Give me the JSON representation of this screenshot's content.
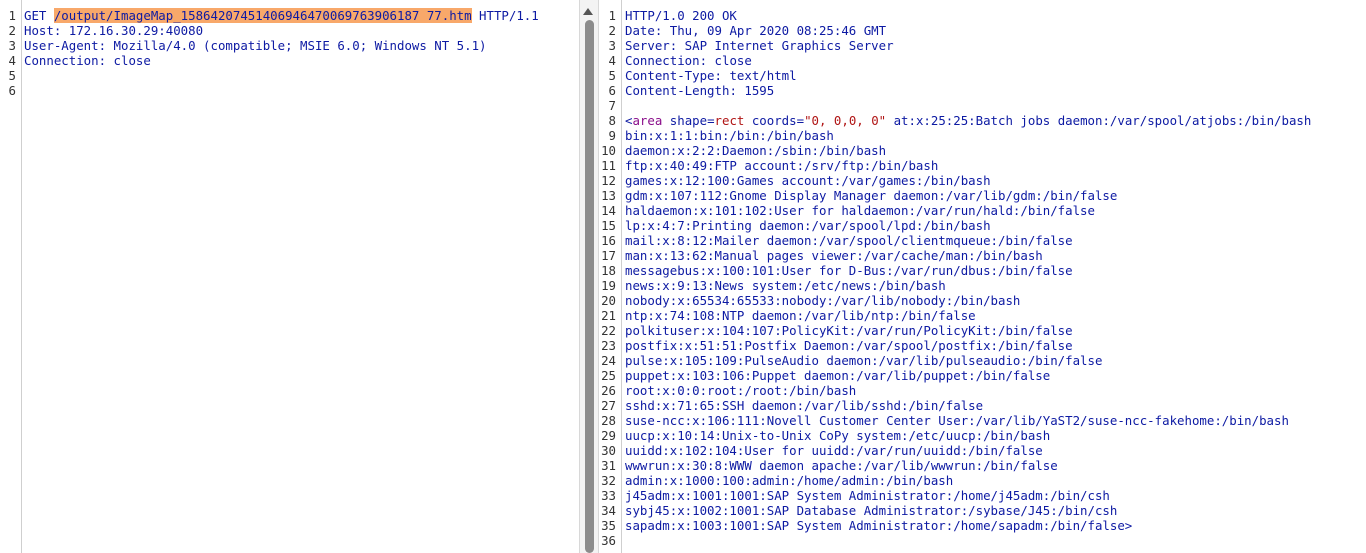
{
  "request": {
    "lines": [
      {
        "n": "1",
        "parts": [
          [
            "t",
            "GET "
          ],
          [
            "hl",
            "/output/ImageMap_15864207451406946470069763906187 77.htm"
          ],
          [
            "t",
            " HTTP/1.1"
          ]
        ]
      },
      {
        "n": "2",
        "parts": [
          [
            "k",
            "Host"
          ],
          [
            "t",
            ": 172.16.30.29:40080"
          ]
        ]
      },
      {
        "n": "3",
        "parts": [
          [
            "k",
            "User-Agent"
          ],
          [
            "t",
            ": Mozilla/4.0 (compatible; MSIE 6.0; Windows NT 5.1)"
          ]
        ]
      },
      {
        "n": "4",
        "parts": [
          [
            "k",
            "Connection"
          ],
          [
            "t",
            ": close"
          ]
        ]
      },
      {
        "n": "5",
        "parts": []
      },
      {
        "n": "6",
        "parts": []
      }
    ]
  },
  "response": {
    "lines": [
      {
        "n": "1",
        "parts": [
          [
            "t",
            "HTTP/1.0 200 OK"
          ]
        ]
      },
      {
        "n": "2",
        "parts": [
          [
            "k",
            "Date"
          ],
          [
            "t",
            ": Thu, 09 Apr 2020 08:25:46 GMT"
          ]
        ]
      },
      {
        "n": "3",
        "parts": [
          [
            "k",
            "Server"
          ],
          [
            "t",
            ": SAP Internet Graphics Server"
          ]
        ]
      },
      {
        "n": "4",
        "parts": [
          [
            "k",
            "Connection"
          ],
          [
            "t",
            ": close"
          ]
        ]
      },
      {
        "n": "5",
        "parts": [
          [
            "k",
            "Content-Type"
          ],
          [
            "t",
            ": text/html"
          ]
        ]
      },
      {
        "n": "6",
        "parts": [
          [
            "k",
            "Content-Length"
          ],
          [
            "t",
            ": 1595"
          ]
        ]
      },
      {
        "n": "7",
        "parts": []
      },
      {
        "n": "8",
        "parts": [
          [
            "tag",
            "<"
          ],
          [
            "attr",
            "area"
          ],
          [
            "tag",
            " shape="
          ],
          [
            "val",
            "rect"
          ],
          [
            "tag",
            " coords="
          ],
          [
            "val",
            "\"0, 0,0, 0\""
          ],
          [
            "tag",
            " at:x:25:25:Batch jobs daemon:/var/spool/atjobs:/bin/bash"
          ]
        ]
      },
      {
        "n": "9",
        "parts": [
          [
            "tag",
            "bin:x:1:1:bin:/bin:/bin/bash"
          ]
        ]
      },
      {
        "n": "10",
        "parts": [
          [
            "tag",
            "daemon:x:2:2:Daemon:/sbin:/bin/bash"
          ]
        ]
      },
      {
        "n": "11",
        "parts": [
          [
            "tag",
            "ftp:x:40:49:FTP account:/srv/ftp:/bin/bash"
          ]
        ]
      },
      {
        "n": "12",
        "parts": [
          [
            "tag",
            "games:x:12:100:Games account:/var/games:/bin/bash"
          ]
        ]
      },
      {
        "n": "13",
        "parts": [
          [
            "tag",
            "gdm:x:107:112:Gnome Display Manager daemon:/var/lib/gdm:/bin/false"
          ]
        ]
      },
      {
        "n": "14",
        "parts": [
          [
            "tag",
            "haldaemon:x:101:102:User for haldaemon:/var/run/hald:/bin/false"
          ]
        ]
      },
      {
        "n": "15",
        "parts": [
          [
            "tag",
            "lp:x:4:7:Printing daemon:/var/spool/lpd:/bin/bash"
          ]
        ]
      },
      {
        "n": "16",
        "parts": [
          [
            "tag",
            "mail:x:8:12:Mailer daemon:/var/spool/clientmqueue:/bin/false"
          ]
        ]
      },
      {
        "n": "17",
        "parts": [
          [
            "tag",
            "man:x:13:62:Manual pages viewer:/var/cache/man:/bin/bash"
          ]
        ]
      },
      {
        "n": "18",
        "parts": [
          [
            "tag",
            "messagebus:x:100:101:User for D-Bus:/var/run/dbus:/bin/false"
          ]
        ]
      },
      {
        "n": "19",
        "parts": [
          [
            "tag",
            "news:x:9:13:News system:/etc/news:/bin/bash"
          ]
        ]
      },
      {
        "n": "20",
        "parts": [
          [
            "tag",
            "nobody:x:65534:65533:nobody:/var/lib/nobody:/bin/bash"
          ]
        ]
      },
      {
        "n": "21",
        "parts": [
          [
            "tag",
            "ntp:x:74:108:NTP daemon:/var/lib/ntp:/bin/false"
          ]
        ]
      },
      {
        "n": "22",
        "parts": [
          [
            "tag",
            "polkituser:x:104:107:PolicyKit:/var/run/PolicyKit:/bin/false"
          ]
        ]
      },
      {
        "n": "23",
        "parts": [
          [
            "tag",
            "postfix:x:51:51:Postfix Daemon:/var/spool/postfix:/bin/false"
          ]
        ]
      },
      {
        "n": "24",
        "parts": [
          [
            "tag",
            "pulse:x:105:109:PulseAudio daemon:/var/lib/pulseaudio:/bin/false"
          ]
        ]
      },
      {
        "n": "25",
        "parts": [
          [
            "tag",
            "puppet:x:103:106:Puppet daemon:/var/lib/puppet:/bin/false"
          ]
        ]
      },
      {
        "n": "26",
        "parts": [
          [
            "tag",
            "root:x:0:0:root:/root:/bin/bash"
          ]
        ]
      },
      {
        "n": "27",
        "parts": [
          [
            "tag",
            "sshd:x:71:65:SSH daemon:/var/lib/sshd:/bin/false"
          ]
        ]
      },
      {
        "n": "28",
        "parts": [
          [
            "tag",
            "suse-ncc:x:106:111:Novell Customer Center User:/var/lib/YaST2/suse-ncc-fakehome:/bin/bash"
          ]
        ]
      },
      {
        "n": "29",
        "parts": [
          [
            "tag",
            "uucp:x:10:14:Unix-to-Unix CoPy system:/etc/uucp:/bin/bash"
          ]
        ]
      },
      {
        "n": "30",
        "parts": [
          [
            "tag",
            "uuidd:x:102:104:User for uuidd:/var/run/uuidd:/bin/false"
          ]
        ]
      },
      {
        "n": "31",
        "parts": [
          [
            "tag",
            "wwwrun:x:30:8:WWW daemon apache:/var/lib/wwwrun:/bin/false"
          ]
        ]
      },
      {
        "n": "32",
        "parts": [
          [
            "tag",
            "admin:x:1000:100:admin:/home/admin:/bin/bash"
          ]
        ]
      },
      {
        "n": "33",
        "parts": [
          [
            "tag",
            "j45adm:x:1001:1001:SAP System Administrator:/home/j45adm:/bin/csh"
          ]
        ]
      },
      {
        "n": "34",
        "parts": [
          [
            "tag",
            "sybj45:x:1002:1001:SAP Database Administrator:/sybase/J45:/bin/csh"
          ]
        ]
      },
      {
        "n": "35",
        "parts": [
          [
            "tag",
            "sapadm:x:1003:1001:SAP System Administrator:/home/sapadm:/bin/false>"
          ]
        ]
      },
      {
        "n": "36",
        "parts": []
      }
    ]
  },
  "icons": {
    "scroll_up": "arrow-up-icon"
  }
}
